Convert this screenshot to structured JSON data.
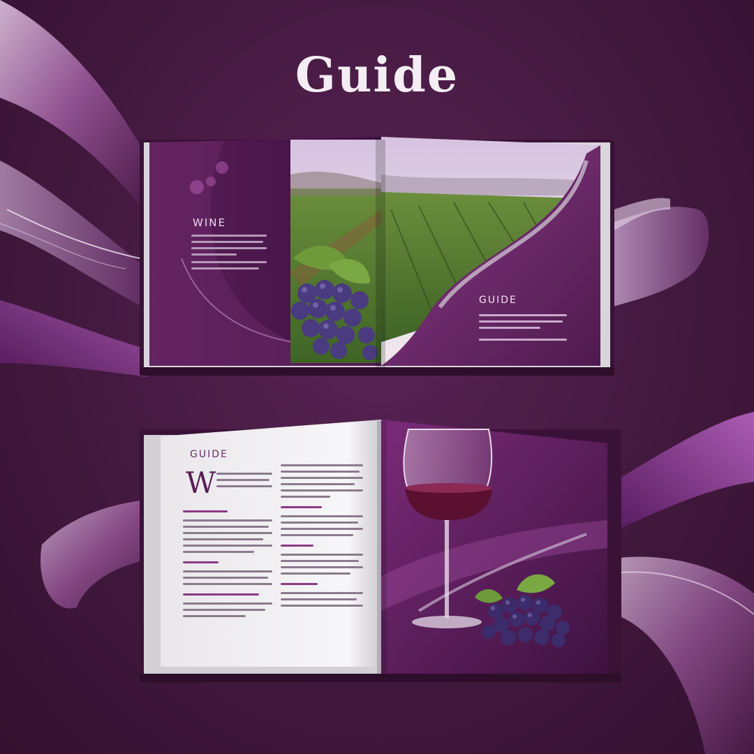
{
  "title": "Guide",
  "book_top": {
    "left_label": "WINE",
    "right_label": "GUIDE"
  },
  "book_bottom": {
    "left_label": "GUIDE",
    "dropcap": "W"
  },
  "colors": {
    "background": "#43193f",
    "accent_purple": "#7b2a78",
    "page_white": "#f2f0f3",
    "wine": "#5b1030",
    "grape": "#3d2c6b",
    "leaf": "#6f9a3a"
  }
}
